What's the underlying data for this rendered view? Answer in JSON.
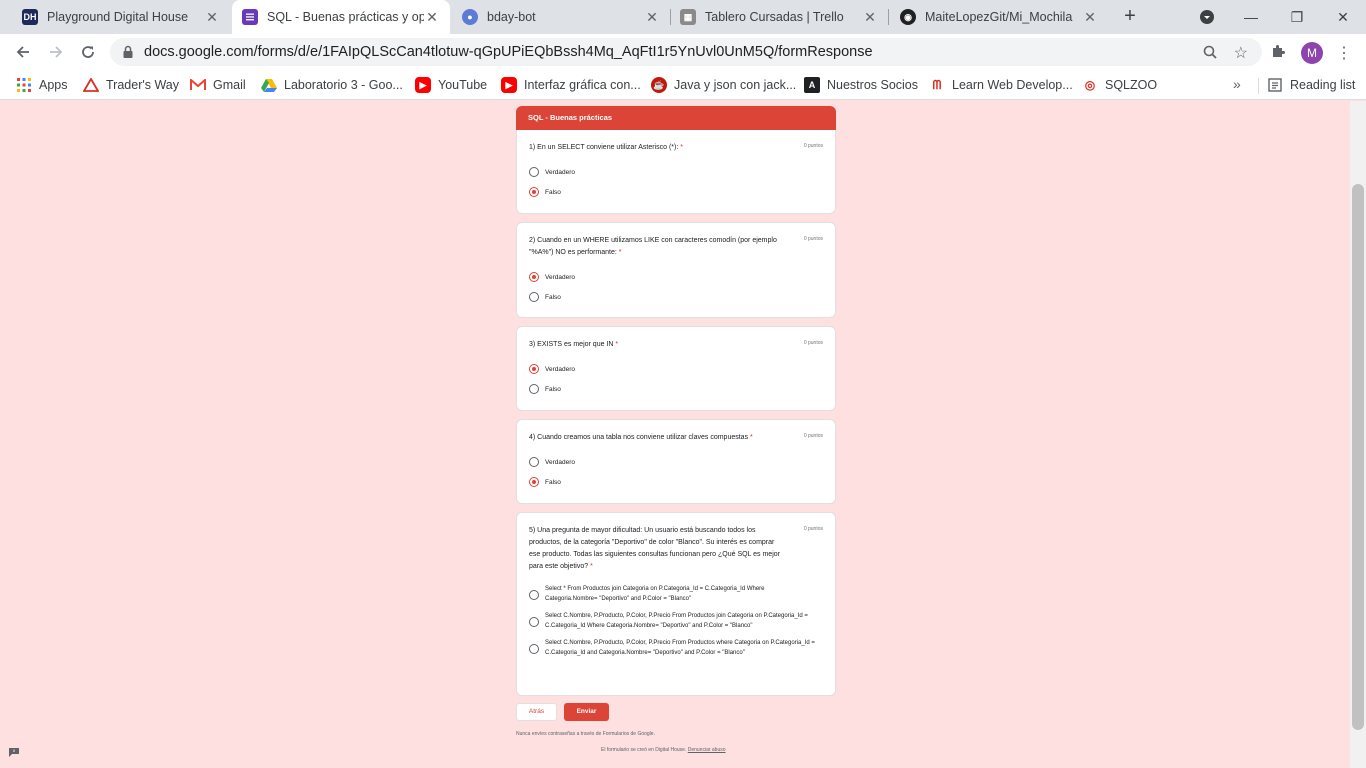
{
  "tabs": [
    {
      "title": "Playground Digital House",
      "icon": "digital-house-icon",
      "color": "#1f2a5c",
      "active": false
    },
    {
      "title": "SQL - Buenas prácticas y opti",
      "icon": "forms-icon",
      "color": "#673ab7",
      "active": true
    },
    {
      "title": "bday-bot",
      "icon": "bot-icon",
      "color": "#5b7bd5",
      "active": false
    },
    {
      "title": "Tablero Cursadas | Trello",
      "icon": "trello-icon",
      "color": "#8a8a8a",
      "active": false
    },
    {
      "title": "MaiteLopezGit/Mi_Mochila",
      "icon": "github-icon",
      "color": "#202124",
      "active": false
    }
  ],
  "browser": {
    "url": "docs.google.com/forms/d/e/1FAIpQLScCan4tlotuw-qGpUPiEQbBssh4Mq_AqFtI1r5YnUvl0UnM5Q/formResponse",
    "profile_initial": "M"
  },
  "bookmarks": [
    {
      "label": "Apps",
      "icon": "apps-grid-icon"
    },
    {
      "label": "Trader's Way",
      "icon": "traders-way-icon"
    },
    {
      "label": "Gmail",
      "icon": "gmail-icon"
    },
    {
      "label": "Laboratorio 3 - Goo...",
      "icon": "drive-icon"
    },
    {
      "label": "YouTube",
      "icon": "youtube-icon"
    },
    {
      "label": "Interfaz gráfica con...",
      "icon": "youtube-icon"
    },
    {
      "label": "Java y json con jack...",
      "icon": "java-icon"
    },
    {
      "label": "Nuestros Socios",
      "icon": "socios-icon"
    },
    {
      "label": "Learn Web Develop...",
      "icon": "mdn-icon"
    },
    {
      "label": "SQLZOO",
      "icon": "sqlzoo-icon"
    }
  ],
  "reading_list": "Reading list",
  "form": {
    "title": "SQL - Buenas prácticas",
    "accent": "#db4437",
    "questions": [
      {
        "title": "1) En un SELECT conviene utilizar Asterisco (*):",
        "points": "0 puntos",
        "options": [
          {
            "label": "Verdadero",
            "selected": false
          },
          {
            "label": "Falso",
            "selected": true
          }
        ]
      },
      {
        "title": "2) Cuando en un WHERE utilizamos LIKE con caracteres comodín (por ejemplo \"%A%\") NO es performante:",
        "points": "0 puntos",
        "options": [
          {
            "label": "Verdadero",
            "selected": true
          },
          {
            "label": "Falso",
            "selected": false
          }
        ]
      },
      {
        "title": "3) EXISTS es mejor que IN",
        "points": "0 puntos",
        "options": [
          {
            "label": "Verdadero",
            "selected": true
          },
          {
            "label": "Falso",
            "selected": false
          }
        ]
      },
      {
        "title": "4) Cuando creamos una tabla nos conviene utilizar claves compuestas",
        "points": "0 puntos",
        "options": [
          {
            "label": "Verdadero",
            "selected": false
          },
          {
            "label": "Falso",
            "selected": true
          }
        ]
      },
      {
        "title": "5) Una pregunta de mayor dificultad: Un usuario está buscando todos los productos, de la categoría \"Deportivo\" de color \"Blanco\". Su interés es comprar ese producto. Todas las siguientes consultas funcionan pero ¿Qué SQL es mejor para este objetivo?",
        "points": "0 puntos",
        "options": [
          {
            "label": "Select * From Productos join Categoria on P.Categoria_Id = C.Categoria_Id Where Categoria.Nombre= \"Deportivo\" and P.Color = \"Blanco\"",
            "selected": false
          },
          {
            "label": "Select C.Nombre, P.Producto, P.Color, P.Precio From Productos join Categoria on P.Categoria_Id = C.Categoria_Id Where Categoria.Nombre= \"Deportivo\" and P.Color = \"Blanco\"",
            "selected": false
          },
          {
            "label": "Select C.Nombre, P.Producto, P.Color, P.Precio From Productos where Categoria on P.Categoria_Id = C.Categoria_Id and Categoria.Nombre= \"Deportivo\" and P.Color = \"Blanco\"",
            "selected": false
          }
        ]
      }
    ],
    "back_label": "Atrás",
    "submit_label": "Enviar",
    "footer_note": "Nunca envíes contraseñas a través de Formularios de Google.",
    "footer_created": "El formulario se creó en Digital House.",
    "footer_abuse": "Denunciar abuso"
  }
}
